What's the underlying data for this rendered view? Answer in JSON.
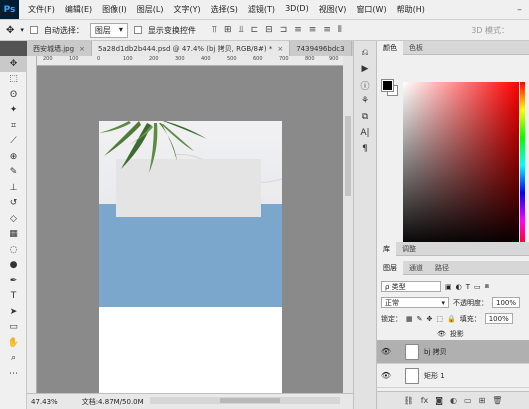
{
  "app": {
    "logo": "Ps"
  },
  "menu": [
    "文件(F)",
    "编辑(E)",
    "图像(I)",
    "图层(L)",
    "文字(Y)",
    "选择(S)",
    "滤镜(T)",
    "3D(D)",
    "视图(V)",
    "窗口(W)",
    "帮助(H)"
  ],
  "options": {
    "auto_select_label": "自动选择：",
    "auto_select_value": "图层",
    "show_transform_label": "显示变换控件",
    "mode_3d": "3D 模式："
  },
  "tabs": [
    {
      "label": "西安城墙.jpg",
      "close": "×"
    },
    {
      "label": "5a28d1db2b444.psd @ 47.4% (bj 拷贝, RGB/8#) *",
      "close": "×"
    },
    {
      "label": "7439496bdc3",
      "close": ""
    }
  ],
  "ruler_top": [
    "200",
    "100",
    "0",
    "100",
    "200",
    "300",
    "400",
    "500",
    "600",
    "700",
    "800",
    "900"
  ],
  "status": {
    "zoom": "47.43%",
    "doc": "文档:4.87M/50.0M",
    "arrow": "›"
  },
  "color_panel": {
    "tab_color": "颜色",
    "tab_swatches": "色板"
  },
  "library_panel": {
    "tab_library": "库",
    "tab_adjust": "调整"
  },
  "layers_panel": {
    "tab_layers": "图层",
    "tab_channels": "通道",
    "tab_paths": "路径",
    "filter_label": "ρ 类型",
    "blend_mode": "正常",
    "opacity_label": "不透明度：",
    "opacity_value": "100%",
    "lock_label": "锁定：",
    "fill_label": "填充：",
    "fill_value": "100%",
    "effect_label": "投影",
    "layers": [
      {
        "name": "bj 拷贝"
      },
      {
        "name": "矩形 1"
      }
    ]
  },
  "footer_icons": [
    "link-icon",
    "fx-icon",
    "mask-icon",
    "adjustment-icon",
    "folder-icon",
    "new-layer-icon",
    "trash-icon"
  ]
}
